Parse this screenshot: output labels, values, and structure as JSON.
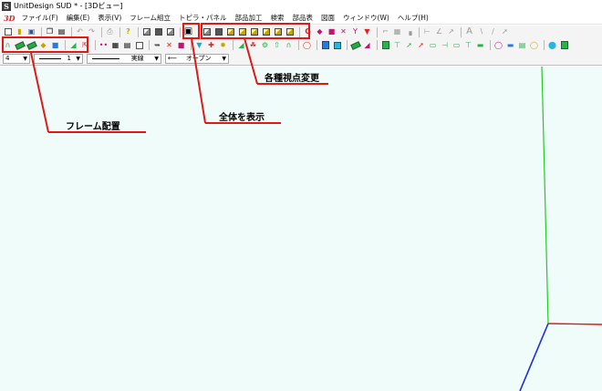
{
  "window": {
    "title": "UnitDesign SUD * - [3Dビュー]",
    "logo_letter": "S"
  },
  "menubar": {
    "mode_label": "3D",
    "items": [
      "ファイル(F)",
      "編集(E)",
      "表示(V)",
      "フレーム組立",
      "トピラ・パネル",
      "部品加工",
      "検索",
      "部品表",
      "図面",
      "ウィンドウ(W)",
      "ヘルプ(H)"
    ]
  },
  "toolbar3": {
    "layer_value": "4",
    "line_width_value": "1",
    "line_type_value": "実線",
    "line_end_value": "オープン"
  },
  "annotations": {
    "frame_placement": "フレーム配置",
    "show_all": "全体を表示",
    "view_change": "各種視点変更"
  },
  "colors": {
    "annotation": "#e01818",
    "axis_x": "#e01818",
    "axis_y": "#22cc22",
    "axis_z": "#1a2fd6",
    "canvas_bg": "#f0fcfa"
  }
}
